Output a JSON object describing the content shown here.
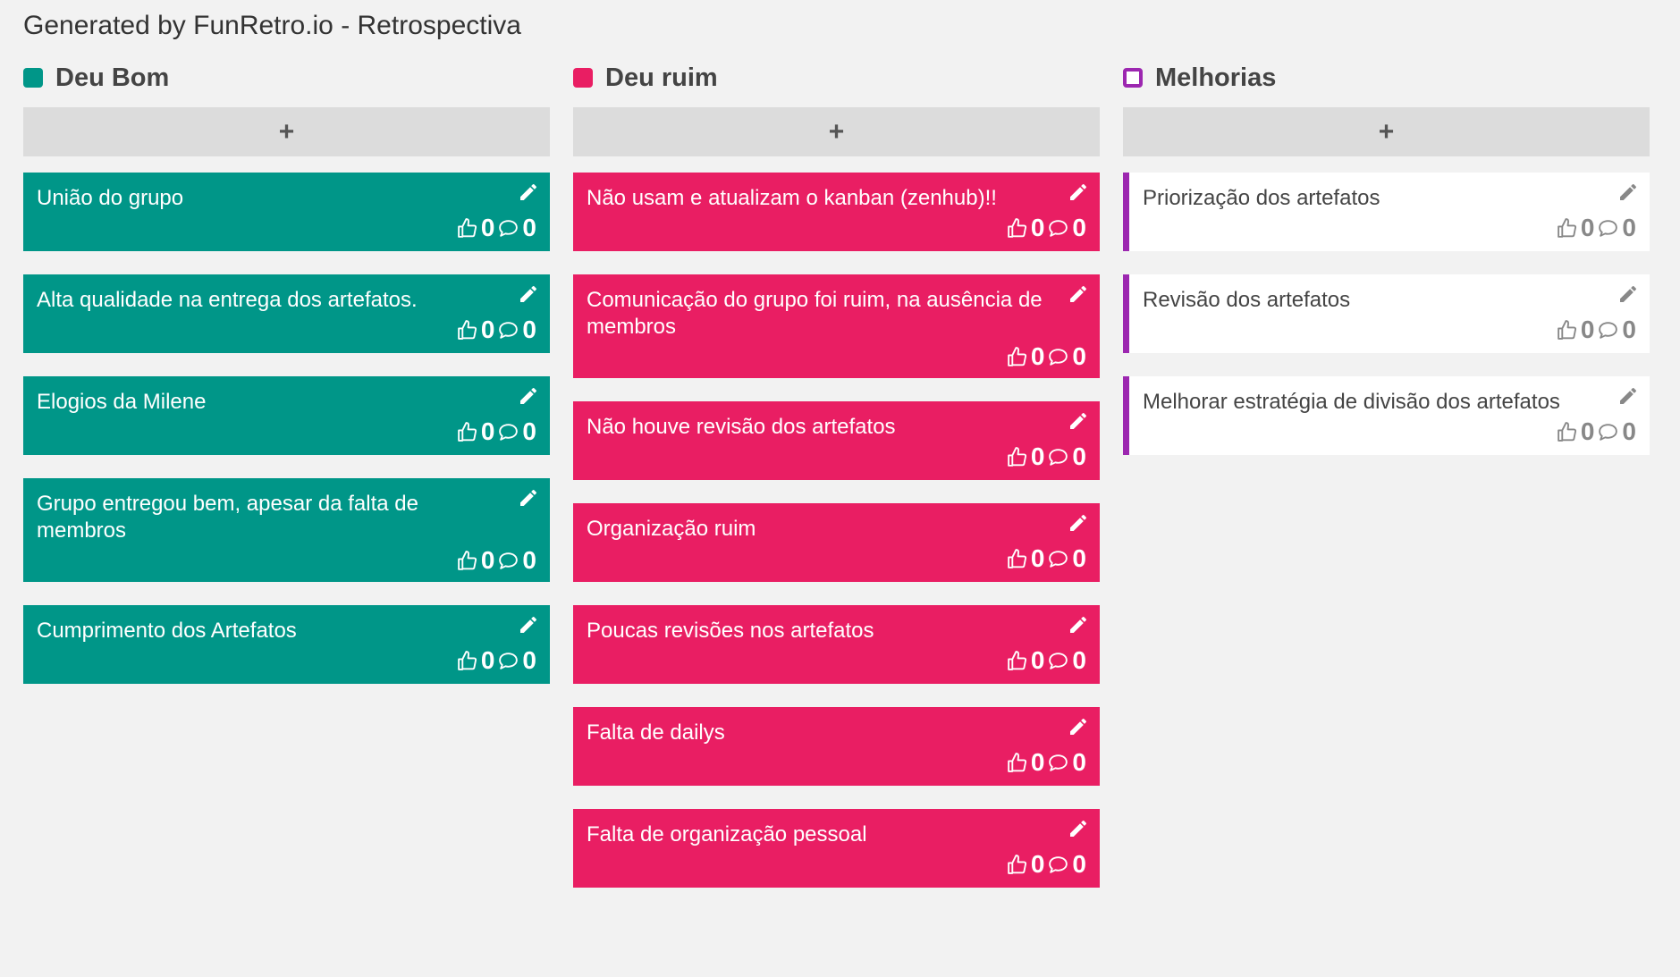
{
  "page": {
    "title": "Generated by FunRetro.io - Retrospectiva"
  },
  "columns": [
    {
      "title": "Deu Bom",
      "color": "#009688",
      "add_label": "+",
      "cards": [
        {
          "text": "União do grupo",
          "votes": "0",
          "comments": "0"
        },
        {
          "text": "Alta qualidade na entrega dos artefatos.",
          "votes": "0",
          "comments": "0"
        },
        {
          "text": "Elogios da Milene",
          "votes": "0",
          "comments": "0"
        },
        {
          "text": "Grupo entregou bem, apesar da falta de membros",
          "votes": "0",
          "comments": "0"
        },
        {
          "text": "Cumprimento dos Artefatos",
          "votes": "0",
          "comments": "0"
        }
      ]
    },
    {
      "title": "Deu ruim",
      "color": "#e91e63",
      "add_label": "+",
      "cards": [
        {
          "text": "Não usam e atualizam o kanban (zenhub)!!",
          "votes": "0",
          "comments": "0"
        },
        {
          "text": "Comunicação do grupo foi ruim, na ausência de membros",
          "votes": "0",
          "comments": "0"
        },
        {
          "text": "Não houve revisão dos artefatos",
          "votes": "0",
          "comments": "0"
        },
        {
          "text": "Organização ruim",
          "votes": "0",
          "comments": "0"
        },
        {
          "text": "Poucas revisões nos artefatos",
          "votes": "0",
          "comments": "0"
        },
        {
          "text": "Falta de dailys",
          "votes": "0",
          "comments": "0"
        },
        {
          "text": "Falta de organização pessoal",
          "votes": "0",
          "comments": "0"
        }
      ]
    },
    {
      "title": "Melhorias",
      "color": "#9c27b0",
      "add_label": "+",
      "cards": [
        {
          "text": "Priorização dos artefatos",
          "votes": "0",
          "comments": "0"
        },
        {
          "text": "Revisão dos artefatos",
          "votes": "0",
          "comments": "0"
        },
        {
          "text": "Melhorar estratégia de divisão dos artefatos",
          "votes": "0",
          "comments": "0"
        }
      ]
    }
  ],
  "icons": {
    "edit": "pencil-icon",
    "vote": "thumbs-up-icon",
    "comment": "comment-icon"
  }
}
